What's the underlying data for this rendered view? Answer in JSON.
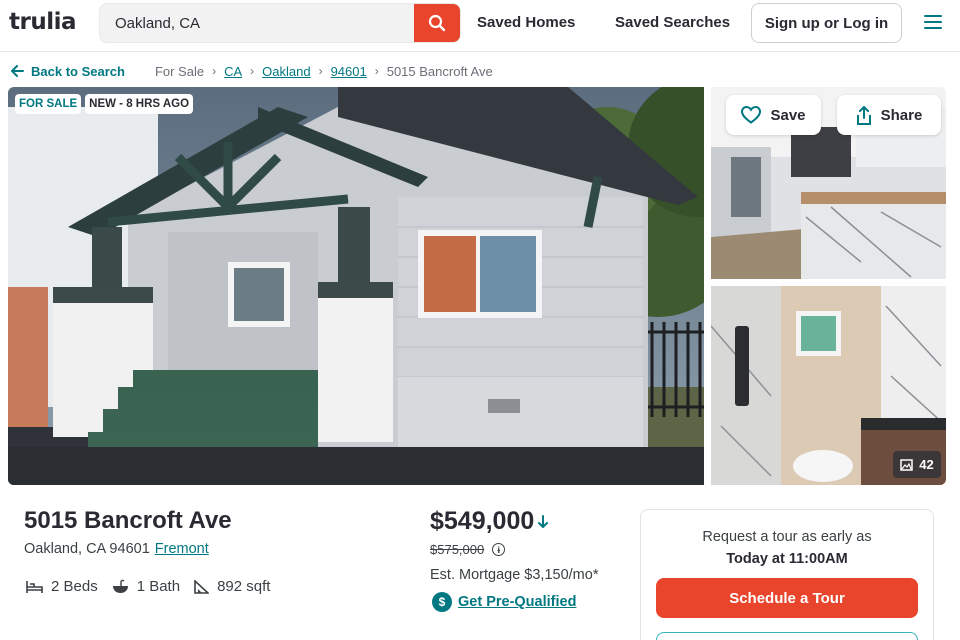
{
  "header": {
    "logo": "trulia",
    "search_value": "Oakland, CA",
    "saved_homes": "Saved Homes",
    "saved_searches": "Saved Searches",
    "sign_in": "Sign up or Log in"
  },
  "breadcrumb": {
    "back": "Back to Search",
    "items": [
      "For Sale",
      "CA",
      "Oakland",
      "94601",
      "5015 Bancroft Ave"
    ]
  },
  "photos": {
    "badge_status": "FOR SALE",
    "badge_new": "NEW - 8 HRS AGO",
    "save": "Save",
    "share": "Share",
    "count": "42"
  },
  "listing": {
    "address": "5015 Bancroft Ave",
    "city": "Oakland, CA 94601",
    "neighborhood": "Fremont",
    "beds": "2 Beds",
    "baths": "1 Bath",
    "sqft": "892 sqft",
    "price": "$549,000",
    "old_price": "$575,000",
    "mortgage": "Est. Mortgage $3,150/mo*",
    "prequal": "Get Pre-Qualified"
  },
  "tour": {
    "line1": "Request a tour as early as",
    "line2": "Today at 11:00AM",
    "button": "Schedule a Tour"
  },
  "colors": {
    "brand_teal": "#007882",
    "accent_orange": "#e8452c"
  }
}
